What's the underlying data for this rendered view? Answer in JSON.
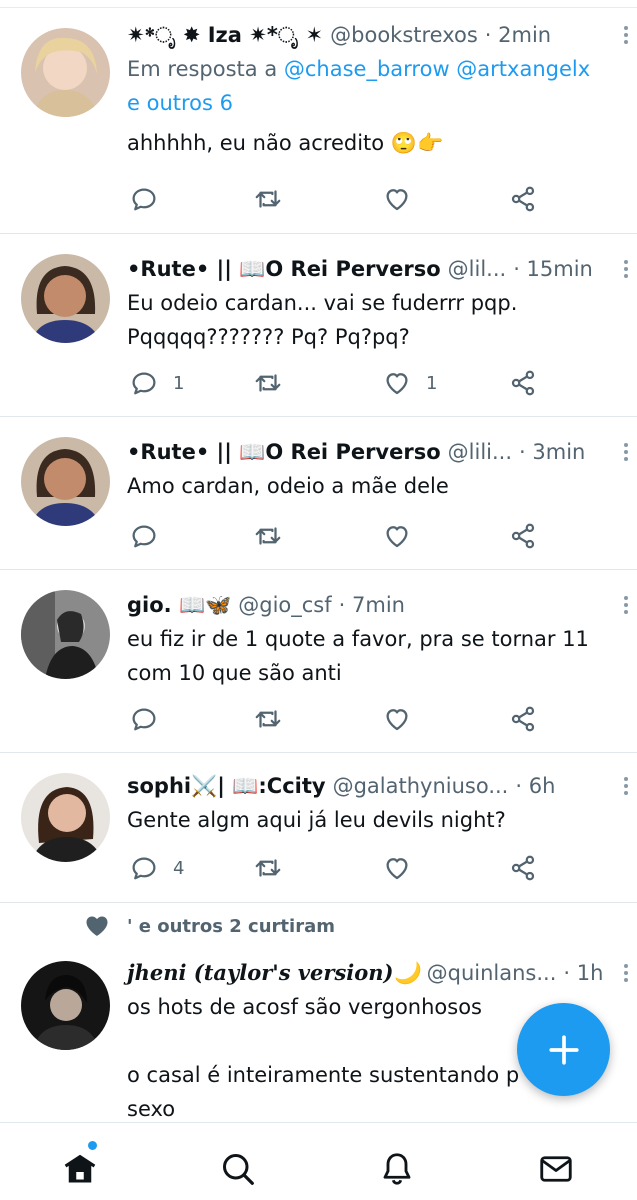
{
  "tweets": [
    {
      "name": "✷*ೃ ✸ Iza ✷*ೃ ✶",
      "handle": "@bookstrexos",
      "time": "· 2min",
      "reply_prefix": "Em resposta a ",
      "reply_users": "@chase_barrow @artxangelx",
      "reply_others": "e outros 6",
      "text": "ahhhhh, eu não acredito 🙄👉",
      "replies": "",
      "likes": ""
    },
    {
      "name": "•Rute• || 📖O Rei Perverso",
      "handle": "@lil...",
      "time": "· 15min",
      "text": "Eu odeio cardan... vai se fuderrr pqp. Pqqqqq??????? Pq? Pq?pq?",
      "replies": "1",
      "likes": "1"
    },
    {
      "name": "•Rute• || 📖O Rei Perverso",
      "handle": "@lili...",
      "time": "· 3min",
      "text": "Amo cardan, odeio a mãe dele",
      "replies": "",
      "likes": ""
    },
    {
      "name": "gio. 📖🦋",
      "handle": "@gio_csf",
      "time": "· 7min",
      "text": "eu fiz ir de 1 quote a favor, pra se tornar 11 com 10 que são anti",
      "replies": "",
      "likes": ""
    },
    {
      "name": "sophi⚔️| 📖:Ccity",
      "handle": "@galathyniuso...",
      "time": "· 6h",
      "text": "Gente algm aqui já leu devils night?",
      "replies": "4",
      "likes": ""
    },
    {
      "social_context": "' e outros 2 curtiram",
      "name": "jheni (taylor's version)🌙",
      "handle": "@quinlans...",
      "time": "· 1h",
      "text_line1": "os hots de acosf são vergonhosos",
      "text_line2": "o casal é inteiramente sustentando p",
      "text_line3": "sexo"
    }
  ],
  "icons": {
    "reply": "reply-icon",
    "retweet": "retweet-icon",
    "like": "heart-icon",
    "share": "share-icon",
    "more": "more-icon",
    "compose": "plus-icon",
    "nav": [
      "home-icon",
      "search-icon",
      "bell-icon",
      "mail-icon"
    ]
  },
  "colors": {
    "accent": "#1d9bf0",
    "secondary_text": "#536471",
    "icon": "#536471"
  }
}
